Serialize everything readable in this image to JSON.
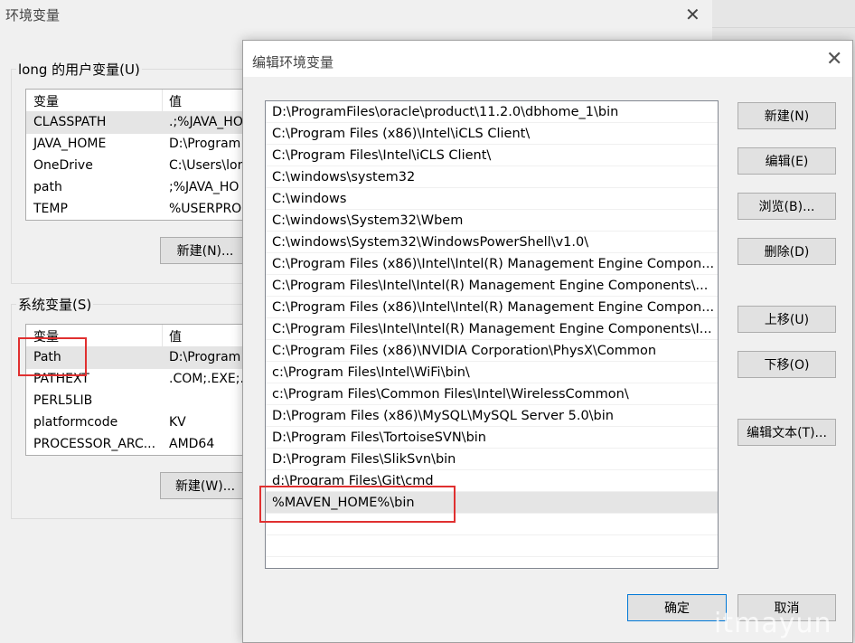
{
  "bg_window": {
    "title": "环境变量",
    "close_glyph": "✕",
    "user_vars": {
      "label": "long 的用户变量(U)",
      "headers": [
        "变量",
        "值"
      ],
      "rows": [
        {
          "name": "CLASSPATH",
          "value": ".;%JAVA_HO"
        },
        {
          "name": "JAVA_HOME",
          "value": "D:\\Program"
        },
        {
          "name": "OneDrive",
          "value": "C:\\Users\\lor"
        },
        {
          "name": "path",
          "value": ";%JAVA_HO"
        },
        {
          "name": "TEMP",
          "value": "%USERPRO"
        }
      ],
      "new_button": "新建(N)..."
    },
    "system_vars": {
      "label": "系统变量(S)",
      "headers": [
        "变量",
        "值"
      ],
      "rows": [
        {
          "name": "Path",
          "value": "D:\\Program"
        },
        {
          "name": "PATHEXT",
          "value": ".COM;.EXE;."
        },
        {
          "name": "PERL5LIB",
          "value": ""
        },
        {
          "name": "platformcode",
          "value": "KV"
        },
        {
          "name": "PROCESSOR_ARC...",
          "value": "AMD64"
        }
      ],
      "new_button": "新建(W)..."
    }
  },
  "edit_dialog": {
    "title": "编辑环境变量",
    "close_glyph": "✕",
    "paths": [
      "D:\\ProgramFiles\\oracle\\product\\11.2.0\\dbhome_1\\bin",
      "C:\\Program Files (x86)\\Intel\\iCLS Client\\",
      "C:\\Program Files\\Intel\\iCLS Client\\",
      "C:\\windows\\system32",
      "C:\\windows",
      "C:\\windows\\System32\\Wbem",
      "C:\\windows\\System32\\WindowsPowerShell\\v1.0\\",
      "C:\\Program Files (x86)\\Intel\\Intel(R) Management Engine Compon...",
      "C:\\Program Files\\Intel\\Intel(R) Management Engine Components\\...",
      "C:\\Program Files (x86)\\Intel\\Intel(R) Management Engine Compon...",
      "C:\\Program Files\\Intel\\Intel(R) Management Engine Components\\I...",
      "C:\\Program Files (x86)\\NVIDIA Corporation\\PhysX\\Common",
      "c:\\Program Files\\Intel\\WiFi\\bin\\",
      "c:\\Program Files\\Common Files\\Intel\\WirelessCommon\\",
      "D:\\Program Files (x86)\\MySQL\\MySQL Server 5.0\\bin",
      "D:\\Program Files\\TortoiseSVN\\bin",
      "D:\\Program Files\\SlikSvn\\bin",
      "d:\\Program Files\\Git\\cmd",
      "%MAVEN_HOME%\\bin",
      "",
      ""
    ],
    "buttons": {
      "new": "新建(N)",
      "edit": "编辑(E)",
      "browse": "浏览(B)...",
      "delete": "删除(D)",
      "move_up": "上移(U)",
      "move_down": "下移(O)",
      "edit_text": "编辑文本(T)...",
      "ok": "确定",
      "cancel": "取消"
    }
  },
  "watermark": "itmayun",
  "colors": {
    "highlight_box": "#e03030",
    "selected_row": "#e5e5e5"
  }
}
